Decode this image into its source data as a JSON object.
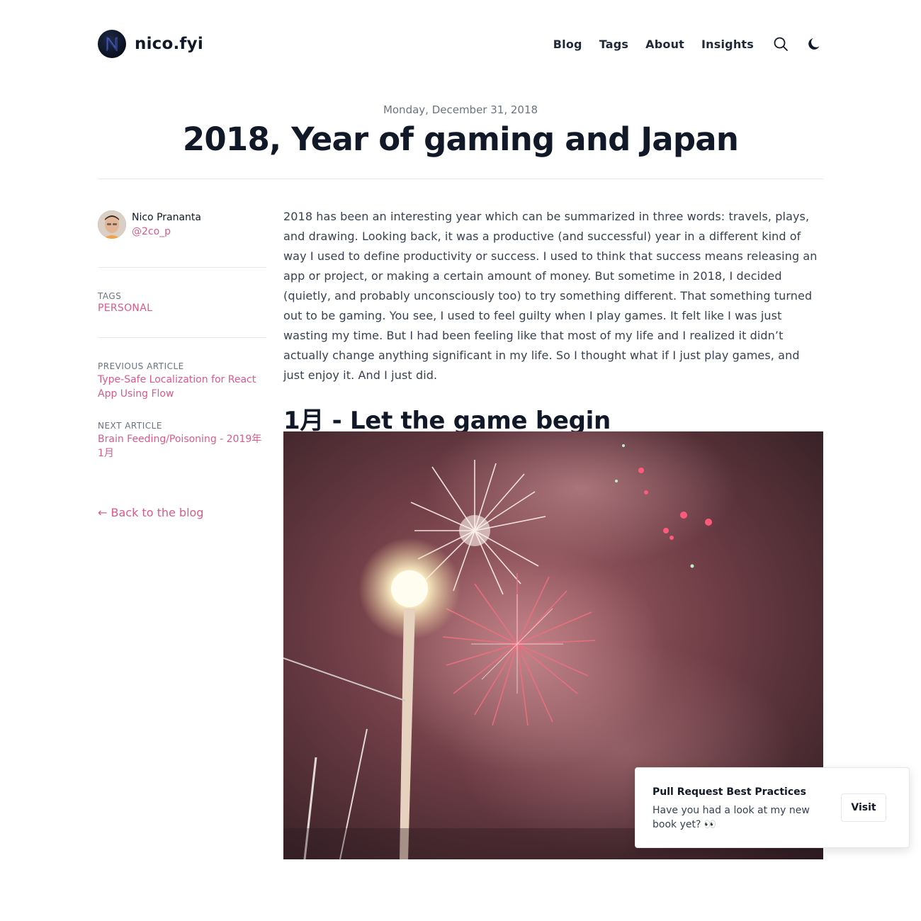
{
  "header": {
    "brand_name": "nico.fyi",
    "nav": [
      {
        "label": "Blog"
      },
      {
        "label": "Tags"
      },
      {
        "label": "About"
      },
      {
        "label": "Insights"
      }
    ],
    "icons": {
      "search": "search-icon",
      "theme": "moon-icon",
      "logo": "nico-logo"
    }
  },
  "post": {
    "date": "Monday, December 31, 2018",
    "title": "2018, Year of gaming and Japan",
    "intro": "2018 has been an interesting year which can be summarized in three words: travels, plays, and drawing. Looking back, it was a productive (and successful) year in a different kind of way I used to define productivity or success. I used to think that success means releasing an app or project, or making a certain amount of money. But sometime in 2018, I decided (quietly, and probably unconsciously too) to try something different. That something turned out to be gaming. You see, I used to feel guilty when I play games. It felt like I was just wasting my time. But I had been feeling like that most of my life and I realized it didn’t actually change anything significant in my life. So I thought what if I just play games, and just enjoy it. And I just did.",
    "section_heading": "1月 - Let the game begin"
  },
  "sidebar": {
    "author_name": "Nico Prananta",
    "author_handle": "@2co_p",
    "tags_label": "TAGS",
    "tag": "PERSONAL",
    "previous_label": "PREVIOUS ARTICLE",
    "previous_title": "Type-Safe Localization for React App Using Flow",
    "next_label": "NEXT ARTICLE",
    "next_title": "Brain Feeding/Poisoning - 2019年1月",
    "back_link": "← Back to the blog"
  },
  "toast": {
    "title": "Pull Request Best Practices",
    "body": "Have you had a look at my new book yet? 👀",
    "button": "Visit"
  },
  "colors": {
    "accent": "#db5a8a",
    "text": "#111827",
    "muted": "#6b7280"
  }
}
